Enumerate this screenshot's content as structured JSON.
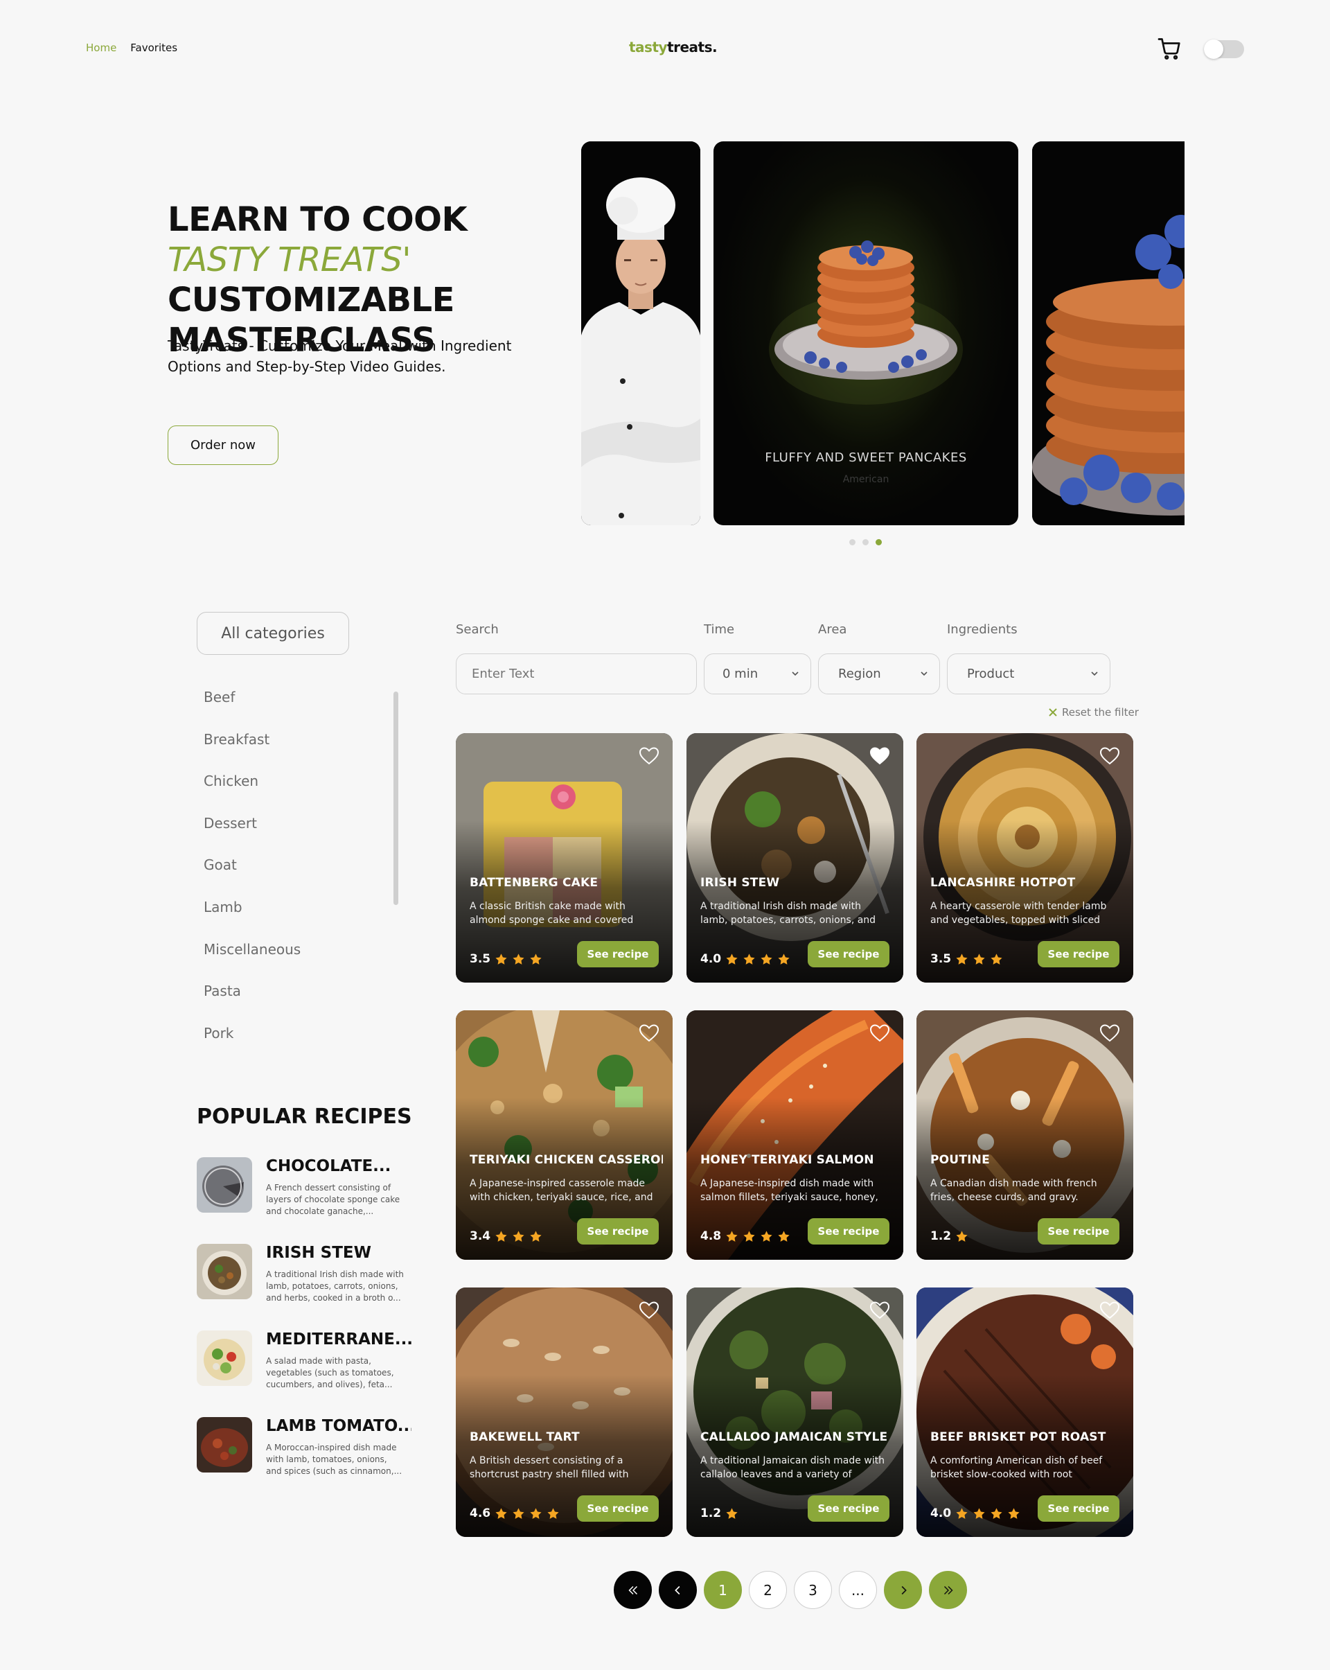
{
  "nav": {
    "home": "Home",
    "favorites": "Favorites"
  },
  "logo": {
    "part1": "tasty",
    "part2": "treats."
  },
  "icons": {
    "cart": "cart-icon",
    "theme_toggle": "toggle-icon"
  },
  "colors": {
    "accent": "#8ba83a",
    "dark": "#050505",
    "star": "#f5a623"
  },
  "hero": {
    "title_a": "LEARN TO COOK ",
    "title_b": "TASTY TREATS'",
    "title_c": " CUSTOMIZABLE MASTERCLASS",
    "subtitle": "TastyTreats - Customize Your Meal with Ingredient Options and Step-by-Step Video Guides.",
    "order_button": "Order now",
    "slide_title": "FLUFFY AND SWEET PANCAKES",
    "slide_area": "American"
  },
  "sidebar": {
    "all_categories": "All categories",
    "categories": [
      "Beef",
      "Breakfast",
      "Chicken",
      "Dessert",
      "Goat",
      "Lamb",
      "Miscellaneous",
      "Pasta",
      "Pork"
    ],
    "popular_title": "POPULAR RECIPES",
    "popular": [
      {
        "title": "CHOCOLATE...",
        "desc": "A French dessert consisting of layers of chocolate sponge cake and chocolate ganache,..."
      },
      {
        "title": "IRISH STEW",
        "desc": "A traditional Irish dish made with lamb, potatoes, carrots, onions, and herbs, cooked in a broth o..."
      },
      {
        "title": "MEDITERRANE...",
        "desc": "A salad made with pasta, vegetables (such as tomatoes, cucumbers, and olives), feta..."
      },
      {
        "title": "LAMB TOMATO...",
        "desc": "A Moroccan-inspired dish made with lamb, tomatoes, onions, and spices (such as cinnamon,..."
      }
    ]
  },
  "filters": {
    "search_label": "Search",
    "search_placeholder": "Enter Text",
    "time_label": "Time",
    "time_value": "0 min",
    "area_label": "Area",
    "area_value": "Region",
    "ingredients_label": "Ingredients",
    "ingredients_value": "Product",
    "reset": "Reset the filter"
  },
  "cards": [
    {
      "title": "BATTENBERG CAKE",
      "desc": "A classic British cake made with almond sponge cake and covered",
      "rating": "3.5",
      "stars": 3,
      "see": "See recipe",
      "fav": false
    },
    {
      "title": "IRISH STEW",
      "desc": "A traditional Irish dish made with lamb, potatoes, carrots, onions, and",
      "rating": "4.0",
      "stars": 4,
      "see": "See recipe",
      "fav": true
    },
    {
      "title": "LANCASHIRE HOTPOT",
      "desc": "A hearty casserole with tender lamb and vegetables, topped with sliced",
      "rating": "3.5",
      "stars": 3,
      "see": "See recipe",
      "fav": false
    },
    {
      "title": "TERIYAKI CHICKEN CASSEROLE",
      "desc": "A Japanese-inspired casserole made with chicken, teriyaki sauce, rice, and",
      "rating": "3.4",
      "stars": 3,
      "see": "See recipe",
      "fav": false
    },
    {
      "title": "HONEY TERIYAKI SALMON",
      "desc": "A Japanese-inspired dish made with salmon fillets, teriyaki sauce, honey,",
      "rating": "4.8",
      "stars": 4,
      "see": "See recipe",
      "fav": false
    },
    {
      "title": "POUTINE",
      "desc": "A Canadian dish made with french fries, cheese curds, and gravy.",
      "rating": "1.2",
      "stars": 1,
      "see": "See recipe",
      "fav": false
    },
    {
      "title": "BAKEWELL TART",
      "desc": "A British dessert consisting of a shortcrust pastry shell filled with",
      "rating": "4.6",
      "stars": 4,
      "see": "See recipe",
      "fav": false
    },
    {
      "title": "CALLALOO JAMAICAN STYLE",
      "desc": "A traditional Jamaican dish made with callaloo leaves and a variety of",
      "rating": "1.2",
      "stars": 1,
      "see": "See recipe",
      "fav": false
    },
    {
      "title": "BEEF BRISKET POT ROAST",
      "desc": "A comforting American dish of beef brisket slow-cooked with root",
      "rating": "4.0",
      "stars": 4,
      "see": "See recipe",
      "fav": false
    }
  ],
  "pagination": {
    "pages": [
      "1",
      "2",
      "3",
      "..."
    ],
    "current": "1"
  }
}
